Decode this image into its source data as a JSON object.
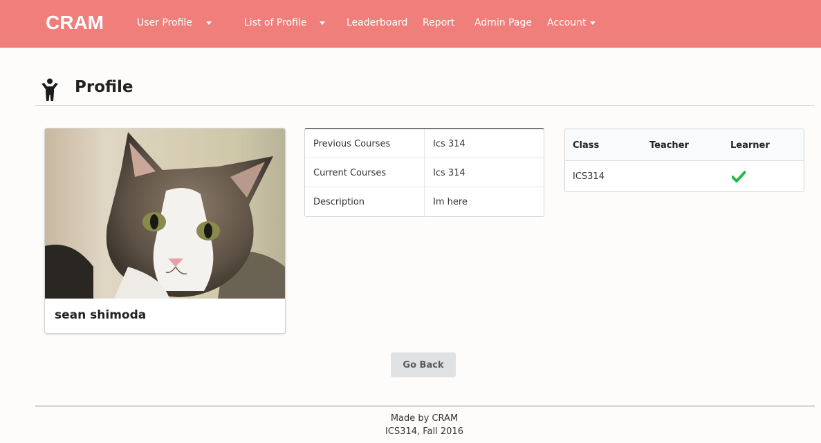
{
  "navbar": {
    "brand": "CRAM",
    "items": [
      {
        "label": "User Profile",
        "has_dropdown": true
      },
      {
        "label": "List of Profile",
        "has_dropdown": true
      },
      {
        "label": "Leaderboard",
        "has_dropdown": false
      },
      {
        "label": "Report",
        "has_dropdown": false
      },
      {
        "label": "Admin Page",
        "has_dropdown": false
      },
      {
        "label": "Account",
        "has_dropdown": true
      }
    ],
    "bg_color": "#f07f7c"
  },
  "header": {
    "title": "Profile",
    "icon": "child-person-icon"
  },
  "profile_card": {
    "image": "cat-photo",
    "name": "sean shimoda"
  },
  "info_table": {
    "rows": [
      {
        "label": "Previous Courses",
        "value": "Ics 314"
      },
      {
        "label": "Current Courses",
        "value": "Ics 314"
      },
      {
        "label": "Description",
        "value": "Im here"
      }
    ]
  },
  "class_table": {
    "headers": [
      "Class",
      "Teacher",
      "Learner"
    ],
    "rows": [
      {
        "class": "ICS314",
        "teacher": false,
        "learner": true
      }
    ],
    "check_color": "#21ba45"
  },
  "go_back_label": "Go Back",
  "footer": {
    "line1": "Made by CRAM",
    "line2": "ICS314, Fall 2016"
  }
}
